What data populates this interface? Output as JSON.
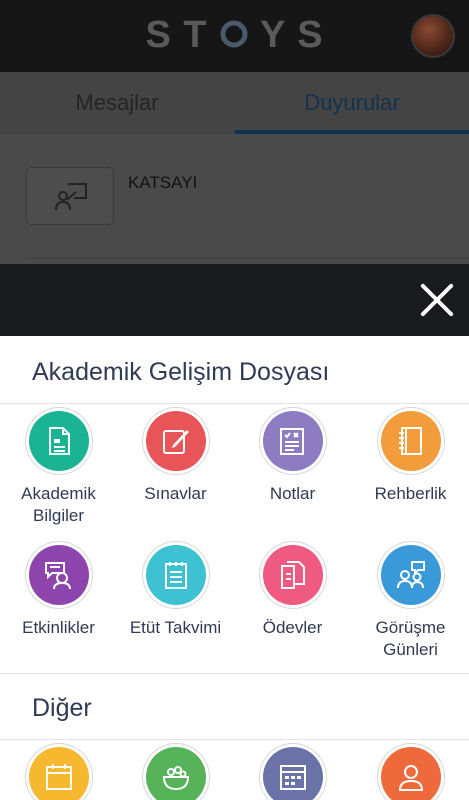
{
  "app": {
    "logo_text": "STOYS"
  },
  "tabs": [
    {
      "label": "Mesajlar"
    },
    {
      "label": "Duyurular"
    }
  ],
  "announcement": {
    "title": "KATSAYI"
  },
  "sections": [
    {
      "title": "Akademik Gelişim Dosyası",
      "items": [
        {
          "label": "Akademik Bilgiler",
          "icon": "document-icon",
          "color": "#1ab394"
        },
        {
          "label": "Sınavlar",
          "icon": "edit-icon",
          "color": "#e85558"
        },
        {
          "label": "Notlar",
          "icon": "grades-icon",
          "color": "#8e7cc3"
        },
        {
          "label": "Rehberlik",
          "icon": "notebook-icon",
          "color": "#f39c3c"
        },
        {
          "label": "Etkinlikler",
          "icon": "chat-user-icon",
          "color": "#8e44ad"
        },
        {
          "label": "Etüt Takvimi",
          "icon": "checklist-icon",
          "color": "#3ec1d3"
        },
        {
          "label": "Ödevler",
          "icon": "copy-icon",
          "color": "#ee5a80"
        },
        {
          "label": "Görüşme Günleri",
          "icon": "meeting-icon",
          "color": "#3a9ad9"
        }
      ]
    },
    {
      "title": "Diğer",
      "items": [
        {
          "label": "",
          "icon": "calendar-icon",
          "color": "#f5b82e"
        },
        {
          "label": "",
          "icon": "food-icon",
          "color": "#56b35a"
        },
        {
          "label": "",
          "icon": "schedule-icon",
          "color": "#6a72a8"
        },
        {
          "label": "",
          "icon": "user-icon",
          "color": "#ee6a3d"
        }
      ]
    }
  ]
}
